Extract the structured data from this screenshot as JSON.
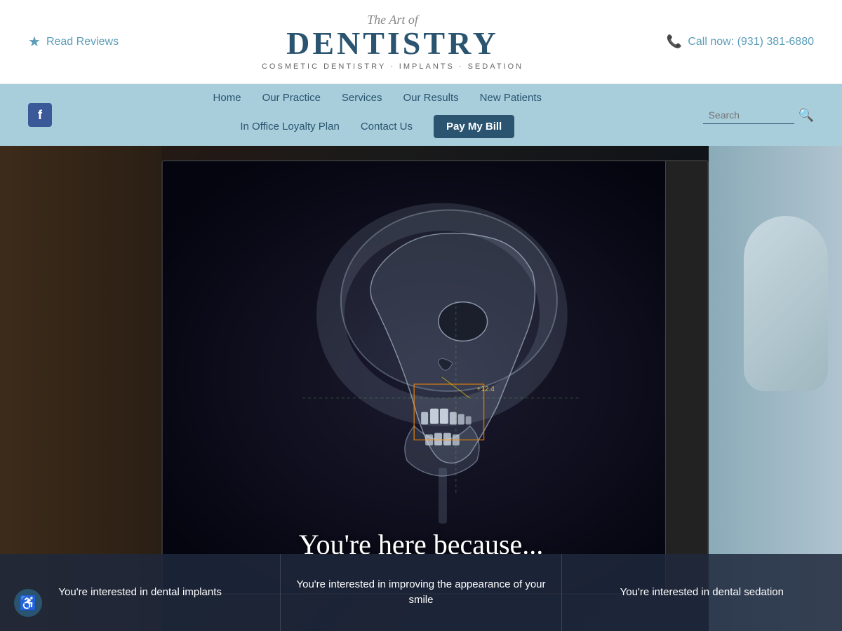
{
  "header": {
    "read_reviews_label": "Read Reviews",
    "logo_art_of": "The Art of",
    "logo_main": "DENTISTRY",
    "logo_sub": "COSMETIC DENTISTRY · IMPLANTS · SEDATION",
    "phone_label": "Call now: (931) 381-6880"
  },
  "nav": {
    "facebook_label": "f",
    "links_row1": [
      {
        "label": "Home",
        "id": "home"
      },
      {
        "label": "Our Practice",
        "id": "our-practice"
      },
      {
        "label": "Services",
        "id": "services"
      },
      {
        "label": "Our Results",
        "id": "our-results"
      },
      {
        "label": "New Patients",
        "id": "new-patients"
      }
    ],
    "links_row2": [
      {
        "label": "In Office Loyalty Plan",
        "id": "loyalty-plan"
      },
      {
        "label": "Contact Us",
        "id": "contact-us"
      },
      {
        "label": "Pay My Bill",
        "id": "pay-my-bill",
        "active": true
      }
    ],
    "search_placeholder": "Search"
  },
  "hero": {
    "headline": "You're here because..."
  },
  "cards": [
    {
      "text": "You're interested in dental implants"
    },
    {
      "text": "You're interested in improving the appearance of your smile"
    },
    {
      "text": "You're interested in dental sedation"
    }
  ],
  "accessibility": {
    "label": "♿"
  }
}
